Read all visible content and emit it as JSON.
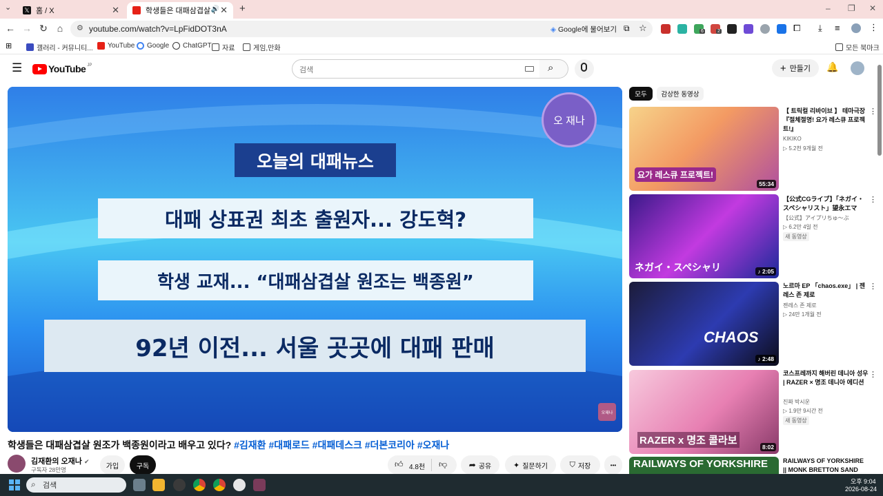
{
  "browser": {
    "tabs": [
      {
        "title": "홈 / X",
        "active": false
      },
      {
        "title": "학생들은 대패삼겹살 원조가 ",
        "active": true
      }
    ],
    "new_tab": "+",
    "window_controls": [
      "–",
      "❐",
      "✕"
    ],
    "url": "youtube.com/watch?v=LpFidDOT3nA",
    "google_chip": "Google에 물어보기",
    "extension_badges": [
      "6",
      "2"
    ],
    "bookmarks": [
      "갤러리 - 커뮤니티...",
      "YouTube",
      "Google",
      "ChatGPT",
      "자료",
      "게임,만화"
    ],
    "all_bookmarks": "모든 북마크"
  },
  "youtube": {
    "logo": "YouTube",
    "region": "JP",
    "search_placeholder": "검색",
    "create_label": "만들기"
  },
  "video": {
    "channel_badge": "오 재나",
    "corner_mark": "오재나",
    "captions": [
      "오늘의 대패뉴스",
      "대패 상표권 최초 출원자... 강도혁?",
      "학생 교재... “대패삼겹살 원조는 백종원”",
      "92년 이전... 서울 곳곳에 대패 판매"
    ],
    "title_text": "학생들은 대패삼겹살 원조가 백종원이라고 배우고 있다?",
    "hashtags": [
      "#김재환",
      "#대패로드",
      "#대패데스크",
      "#더본코리아",
      "#오재나"
    ],
    "channel_name": "김재환의 오재나",
    "subscribers": "구독자 28만명",
    "join_label": "가입",
    "subscribe_label": "구독",
    "likes": "4.8천",
    "share_label": "공유",
    "ask_label": "질문하기",
    "save_label": "저장",
    "more_label": "•••"
  },
  "sidebar": {
    "chips": [
      "모두",
      "감상한 동영상"
    ],
    "items": [
      {
        "title": "【 트릭컬 리바이브 】 테마극장 『절체절명! 요가 레스큐 프로젝트!』",
        "channel": "KIKIKO",
        "meta": "▷ 5.2천   9개월 전",
        "badge": "",
        "duration": "55:34"
      },
      {
        "title": "【公式CGライブ】「ネガイ・スペシャリスト」望永エマ",
        "channel": "【公式】アイプリちゅ〜ぶ",
        "meta": "▷ 6.2만   4일 전",
        "badge": "새 동영상",
        "duration": "♪ 2:05"
      },
      {
        "title": "노르마 EP 「chaos.exe」 | 젠레스 존 제로",
        "channel": "젠레스 존 제로",
        "meta": "▷ 24만   1개월 전",
        "badge": "",
        "duration": "♪ 2:48"
      },
      {
        "title": "코스프레까지 해버린 데니아 성우 | RAZER × 명조 데니아 에디션",
        "channel": "진짜 박시운",
        "meta": "▷ 1.9만   9시간 전",
        "badge": "새 동영상",
        "duration": "8:02"
      },
      {
        "title": "RAILWAYS OF YORKSHIRE || MONK BRETTON SAND",
        "channel": "",
        "meta": "",
        "badge": "",
        "duration": ""
      }
    ],
    "thumb_texts": [
      "요가 레스큐 프로젝트!",
      "ネガイ・スペシャリ",
      "CHAOS",
      "RAZER x 명조 콜라보",
      "RAILWAYS OF YORKSHIRE"
    ]
  },
  "taskbar": {
    "search_placeholder": "검색",
    "time": "오후 9:04",
    "date": "2026-08-24"
  }
}
